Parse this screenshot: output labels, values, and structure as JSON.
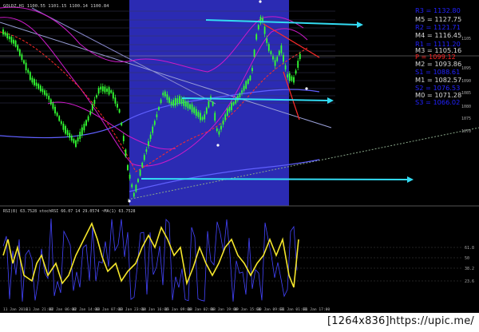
{
  "window": {
    "symbol_line": "GOLDZ,H1  1100.55 1101.15 1100.14 1100.84"
  },
  "colors": {
    "background": "#000000",
    "session_box": "#2b2bb3",
    "candle": "#33ff33",
    "ma_red": "#ff2a2a",
    "envelope": "#cc1ac8",
    "arrow": "#33dbf2",
    "rsi_line": "#f5e62b",
    "stoch_line": "#4444ff",
    "trend_line": "#d8d8d8",
    "level_labels": [
      "#2222ff",
      "#d8d8d8",
      "#ff2222"
    ]
  },
  "pivot_levels": [
    {
      "name": "R3",
      "value": "1132.80",
      "label": "R3 = 1132.80",
      "color": "#2222ff"
    },
    {
      "name": "M5",
      "value": "1127.75",
      "label": "M5 = 1127.75",
      "color": "#d8d8d8"
    },
    {
      "name": "R2",
      "value": "1121.71",
      "label": "R2 = 1121.71",
      "color": "#2222ff"
    },
    {
      "name": "M4",
      "value": "1116.45",
      "label": "M4 = 1116.45",
      "color": "#d8d8d8"
    },
    {
      "name": "R1",
      "value": "1111.20",
      "label": "R1 = 1111.20",
      "color": "#2222ff"
    },
    {
      "name": "M3",
      "value": "1105.16",
      "label": "M3 = 1105.16",
      "color": "#d8d8d8"
    },
    {
      "name": "P",
      "value": "1099.12",
      "label": "P  = 1099.12",
      "color": "#ff2222"
    },
    {
      "name": "M2",
      "value": "1093.86",
      "label": "M2 = 1093.86",
      "color": "#d8d8d8"
    },
    {
      "name": "S1",
      "value": "1088.61",
      "label": "S1 = 1088.61",
      "color": "#2222ff"
    },
    {
      "name": "M1",
      "value": "1082.57",
      "label": "M1 = 1082.57",
      "color": "#d8d8d8"
    },
    {
      "name": "S2",
      "value": "1076.53",
      "label": "S2 = 1076.53",
      "color": "#2222ff"
    },
    {
      "name": "M0",
      "value": "1071.28",
      "label": "M0 = 1071.28",
      "color": "#d8d8d8"
    },
    {
      "name": "S3",
      "value": "1066.02",
      "label": "S3 = 1066.02",
      "color": "#2222ff"
    }
  ],
  "price_axis": [
    "1105",
    "1095",
    "1090",
    "1085",
    "1080",
    "1075",
    "1070"
  ],
  "indicator": {
    "legend": "RSI(8) 63.7528   stochRSI 66.07 14 29.0574  ~MA(1) 63.7528",
    "axis_labels": [
      "61.8",
      "50",
      "38.2",
      "23.6"
    ]
  },
  "time_axis": [
    "11 Jan 2016",
    "11 Jan 21:00",
    "12 Jan 06:00",
    "12 Jan 14:00",
    "13 Jan 07:00",
    "13 Jan 23:00",
    "14 Jan 16:00",
    "15 Jan 09:00",
    "18 Jan 02:00",
    "18 Jan 19:00",
    "19 Jan 15:00",
    "20 Jan 09:00",
    "21 Jan 01:00",
    "21 Jan 17:00"
  ],
  "caption": "[1264x836]https://upic.me/"
}
